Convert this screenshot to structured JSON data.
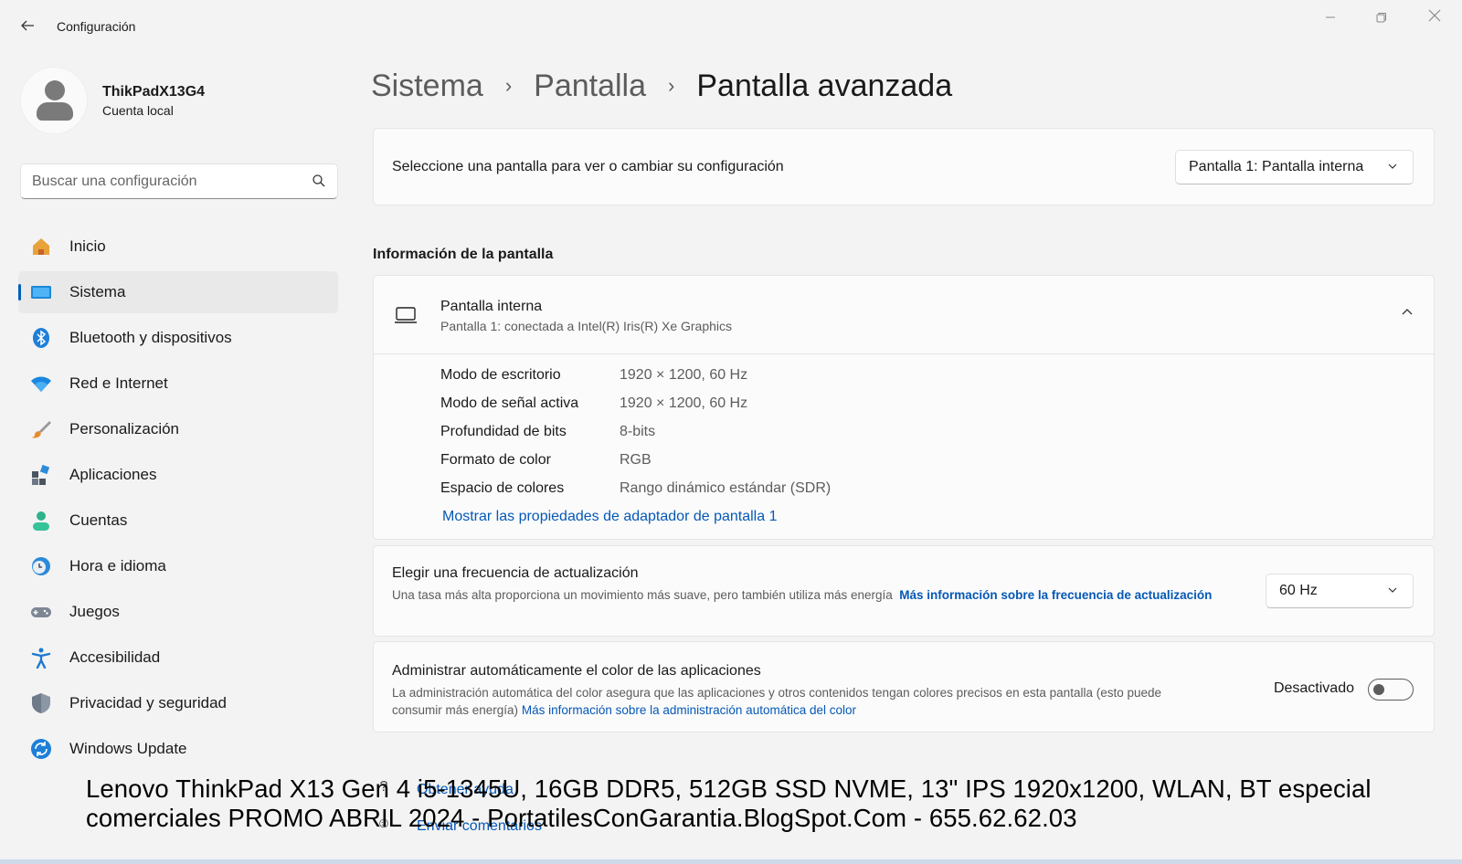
{
  "window": {
    "title": "Configuración",
    "back_icon": "arrow-left-icon",
    "minimize_icon": "minimize-icon",
    "maximize_icon": "restore-icon",
    "close_icon": "close-icon"
  },
  "profile": {
    "name": "ThikPadX13G4",
    "account_type": "Cuenta local"
  },
  "search": {
    "placeholder": "Buscar una configuración"
  },
  "sidebar": {
    "items": [
      {
        "label": "Inicio",
        "icon": "home-icon",
        "active": false
      },
      {
        "label": "Sistema",
        "icon": "system-icon",
        "active": true
      },
      {
        "label": "Bluetooth y dispositivos",
        "icon": "bluetooth-icon",
        "active": false
      },
      {
        "label": "Red e Internet",
        "icon": "wifi-icon",
        "active": false
      },
      {
        "label": "Personalización",
        "icon": "brush-icon",
        "active": false
      },
      {
        "label": "Aplicaciones",
        "icon": "apps-icon",
        "active": false
      },
      {
        "label": "Cuentas",
        "icon": "accounts-icon",
        "active": false
      },
      {
        "label": "Hora e idioma",
        "icon": "time-language-icon",
        "active": false
      },
      {
        "label": "Juegos",
        "icon": "gamepad-icon",
        "active": false
      },
      {
        "label": "Accesibilidad",
        "icon": "accessibility-icon",
        "active": false
      },
      {
        "label": "Privacidad y seguridad",
        "icon": "shield-icon",
        "active": false
      },
      {
        "label": "Windows Update",
        "icon": "update-icon",
        "active": false
      }
    ]
  },
  "breadcrumb": [
    "Sistema",
    "Pantalla",
    "Pantalla avanzada"
  ],
  "display_select": {
    "label": "Seleccione una pantalla para ver o cambiar su configuración",
    "value": "Pantalla 1: Pantalla interna"
  },
  "display_info": {
    "section_title": "Información de la pantalla",
    "title": "Pantalla interna",
    "subtitle": "Pantalla 1: conectada a Intel(R) Iris(R) Xe Graphics",
    "rows": [
      {
        "key": "Modo de escritorio",
        "value": "1920 × 1200, 60 Hz"
      },
      {
        "key": "Modo de señal activa",
        "value": "1920 × 1200, 60 Hz"
      },
      {
        "key": "Profundidad de bits",
        "value": "8-bits"
      },
      {
        "key": "Formato de color",
        "value": "RGB"
      },
      {
        "key": "Espacio de colores",
        "value": "Rango dinámico estándar (SDR)"
      }
    ],
    "adapter_link": "Mostrar las propiedades de adaptador de pantalla 1"
  },
  "refresh_rate": {
    "title": "Elegir una frecuencia de actualización",
    "description": "Una tasa más alta proporciona un movimiento más suave, pero también utiliza más energía",
    "link": "Más información sobre la frecuencia de actualización",
    "value": "60 Hz"
  },
  "auto_color": {
    "title": "Administrar automáticamente el color de las aplicaciones",
    "description": "La administración automática del color asegura que las aplicaciones y otros contenidos tengan colores precisos en esta pantalla (esto puede consumir más energía)",
    "link": "Más información sobre la administración automática del color",
    "toggle_label": "Desactivado",
    "enabled": false
  },
  "bottom_links": [
    {
      "label": "Obtener ayuda",
      "icon": "help-icon"
    },
    {
      "label": "Enviar comentarios",
      "icon": "feedback-icon"
    }
  ],
  "watermark": {
    "line1": "Lenovo ThinkPad X13 Gen 4 i5-1345U, 16GB DDR5, 512GB SSD NVME, 13\" IPS 1920x1200, WLAN, BT especial",
    "line2": "comerciales PROMO ABRIL 2024 - PortatilesConGarantia.BlogSpot.Com - 655.62.62.03"
  },
  "colors": {
    "accent": "#005fb8",
    "link": "#0558b7",
    "background": "#f3f3f3",
    "card": "#fbfbfb"
  }
}
